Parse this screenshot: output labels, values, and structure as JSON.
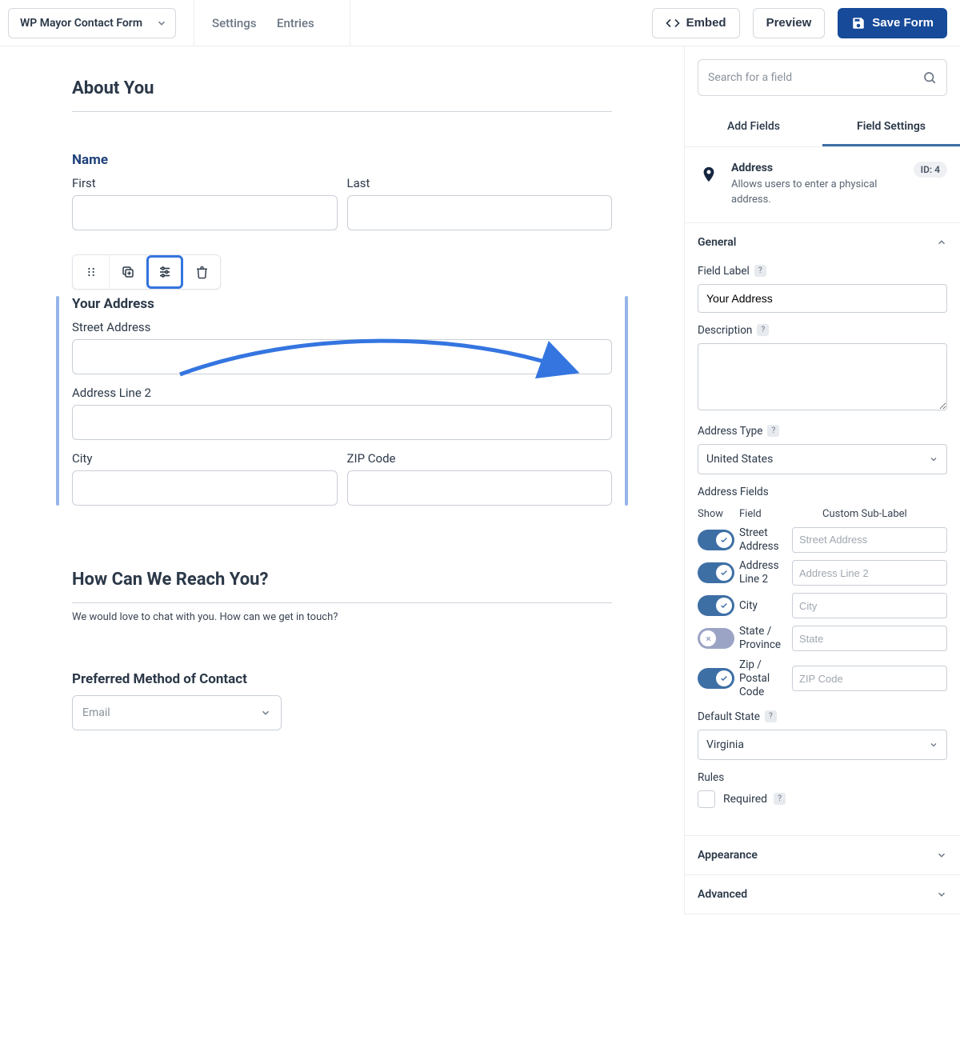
{
  "topbar": {
    "form_name": "WP Mayor Contact Form",
    "settings": "Settings",
    "entries": "Entries",
    "embed": "Embed",
    "preview": "Preview",
    "save": "Save Form"
  },
  "canvas": {
    "about_you": "About You",
    "name": {
      "label": "Name",
      "first": "First",
      "last": "Last"
    },
    "address": {
      "label": "Your Address",
      "street": "Street Address",
      "line2": "Address Line 2",
      "city": "City",
      "zip": "ZIP Code"
    },
    "reach_you": {
      "title": "How Can We Reach You?",
      "desc": "We would love to chat with you. How can we get in touch?"
    },
    "preferred": {
      "label": "Preferred Method of Contact",
      "value": "Email"
    }
  },
  "sidebar": {
    "search_placeholder": "Search for a field",
    "tabs": {
      "add": "Add Fields",
      "settings": "Field Settings"
    },
    "field": {
      "title": "Address",
      "desc": "Allows users to enter a physical address.",
      "id": "ID: 4"
    },
    "sections": {
      "general": "General",
      "appearance": "Appearance",
      "advanced": "Advanced"
    },
    "labels": {
      "field_label": "Field Label",
      "description": "Description",
      "address_type": "Address Type",
      "address_fields": "Address Fields",
      "default_state": "Default State",
      "rules": "Rules",
      "required": "Required",
      "show": "Show",
      "field": "Field",
      "custom_sub": "Custom Sub-Label"
    },
    "values": {
      "field_label": "Your Address",
      "address_type": "United States",
      "default_state": "Virginia"
    },
    "address_fields": [
      {
        "label": "Street Address",
        "on": true,
        "placeholder": "Street Address"
      },
      {
        "label": "Address Line 2",
        "on": true,
        "placeholder": "Address Line 2"
      },
      {
        "label": "City",
        "on": true,
        "placeholder": "City"
      },
      {
        "label": "State / Province",
        "on": false,
        "placeholder": "State"
      },
      {
        "label": "Zip / Postal Code",
        "on": true,
        "placeholder": "ZIP Code"
      }
    ]
  }
}
